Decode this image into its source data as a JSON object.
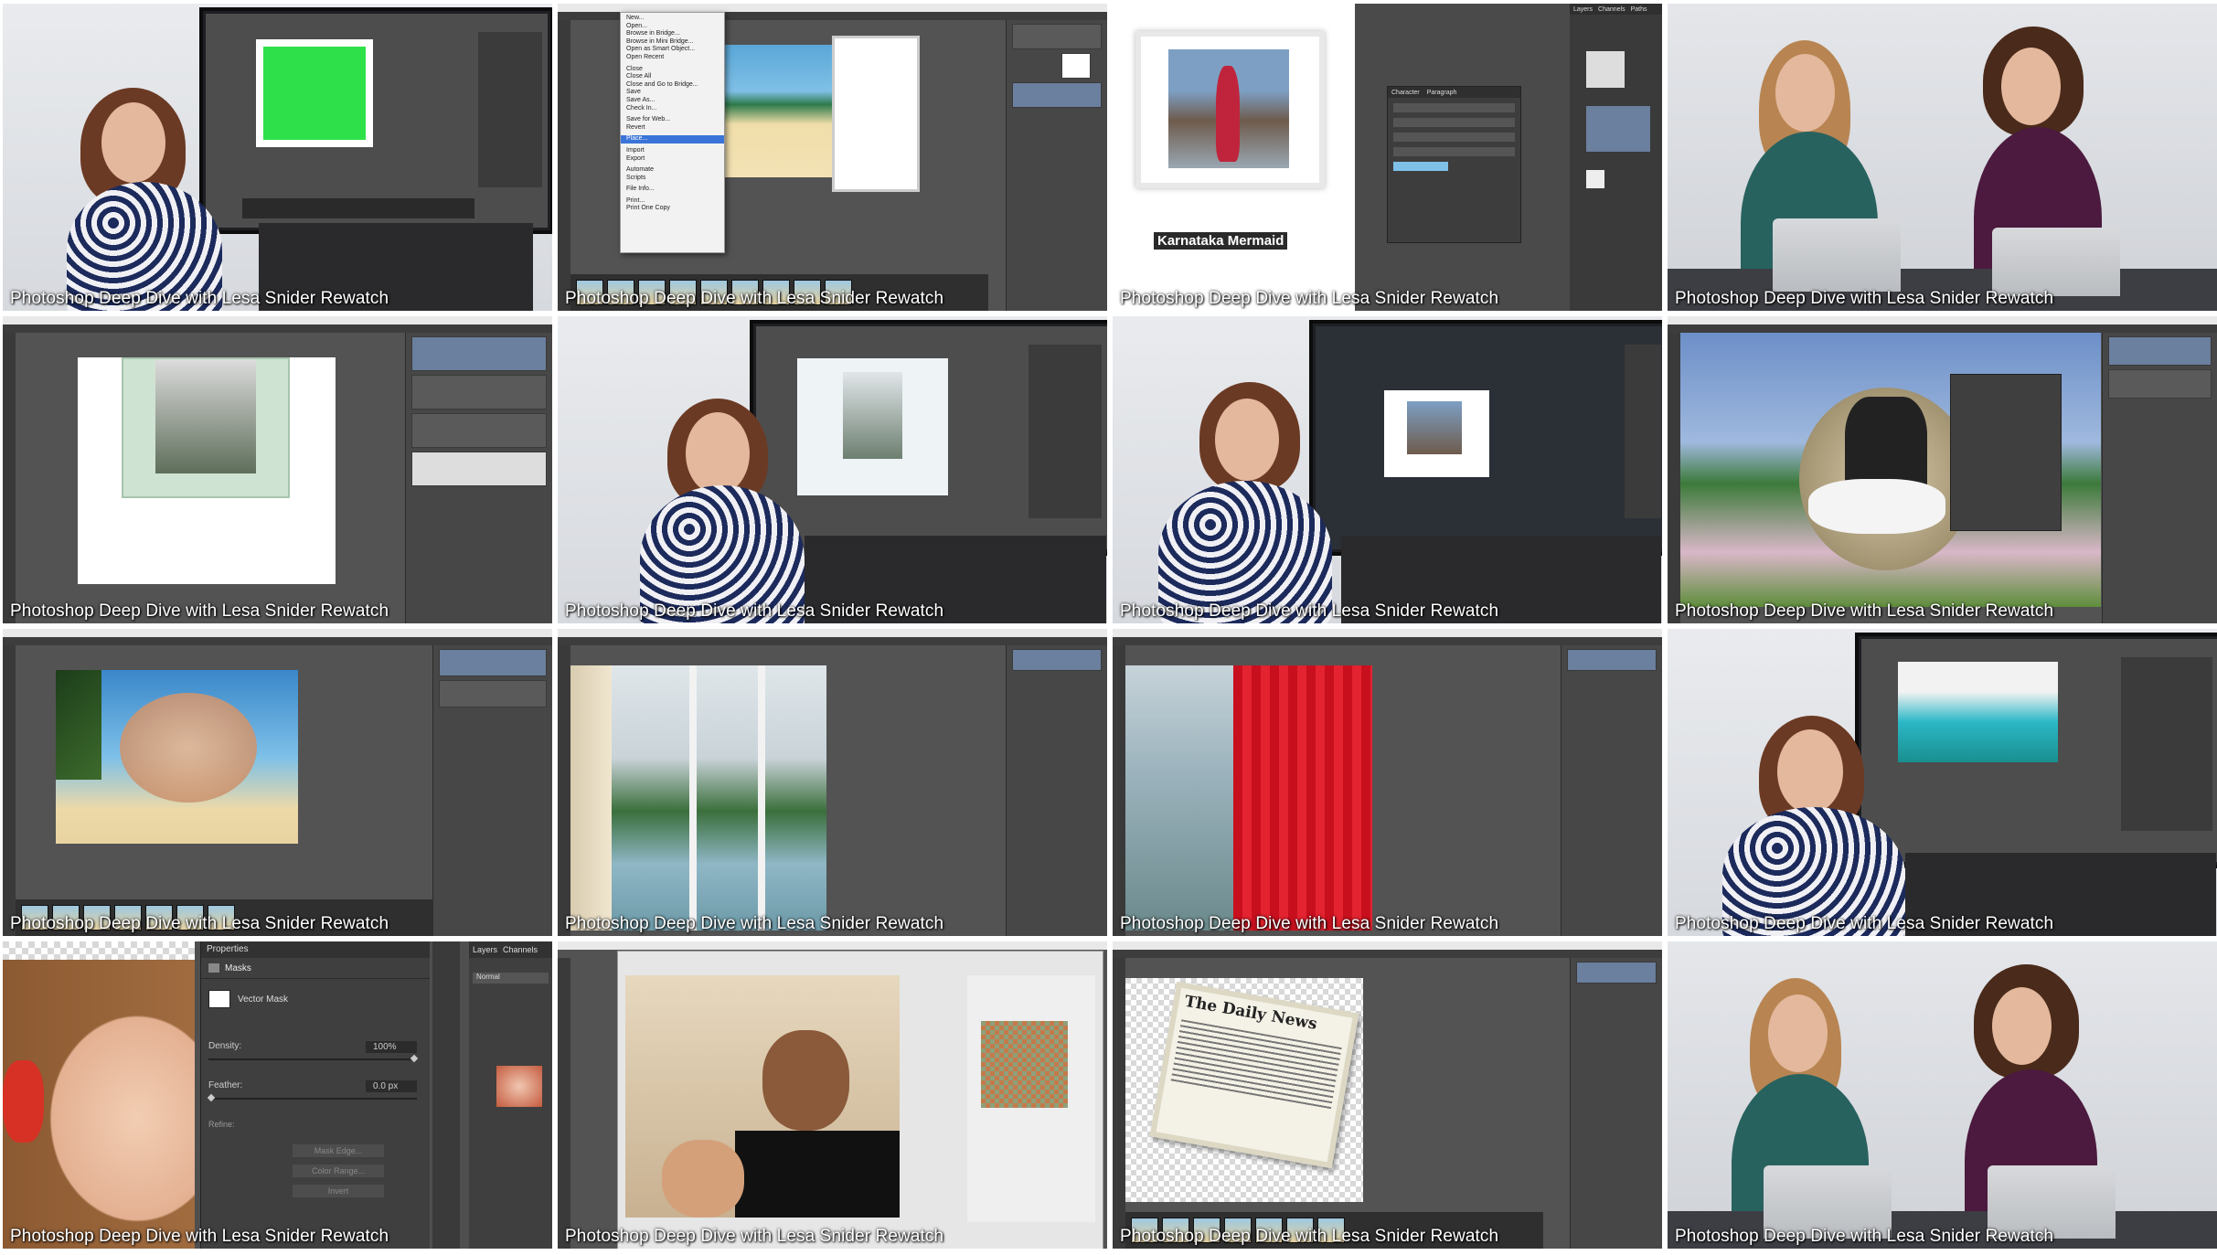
{
  "caption": "Photoshop Deep Dive with Lesa Snider Rewatch",
  "tiles": [
    {
      "scene": "instructor-with-monitor-green-screen"
    },
    {
      "scene": "photoshop-file-menu",
      "menu_items": [
        "New...",
        "Open...",
        "Browse in Bridge...",
        "Browse in Mini Bridge...",
        "Open as Smart Object...",
        "Open Recent",
        "Close",
        "Close All",
        "Close and Go to Bridge...",
        "Save",
        "Save As...",
        "Check In...",
        "Save for Web...",
        "Revert",
        "Place...",
        "Import",
        "Export",
        "Automate",
        "Scripts",
        "File Info...",
        "Print...",
        "Print One Copy"
      ],
      "highlighted": "Place..."
    },
    {
      "scene": "photoshop-character-panel",
      "title_text": "Karnataka Mermaid",
      "panel_tabs": [
        "Character",
        "Paragraph"
      ],
      "layers_tabs": [
        "Layers",
        "Channels",
        "Paths"
      ]
    },
    {
      "scene": "two-hosts-with-laptops"
    },
    {
      "scene": "photoshop-framed-photo"
    },
    {
      "scene": "instructor-with-monitor-beach-photo"
    },
    {
      "scene": "instructor-with-monitor-mermaid-photo"
    },
    {
      "scene": "photoshop-wedding-mask"
    },
    {
      "scene": "photoshop-beach-face-blend"
    },
    {
      "scene": "photoshop-window-mountains"
    },
    {
      "scene": "photoshop-red-curtain"
    },
    {
      "scene": "instructor-with-monitor-window-scene"
    },
    {
      "scene": "photoshop-properties-panel",
      "panel_title": "Properties",
      "section": "Masks",
      "mask_label": "Vector Mask",
      "density_label": "Density:",
      "density_value": "100%",
      "feather_label": "Feather:",
      "feather_value": "0.0 px",
      "refine_label": "Refine:",
      "buttons": [
        "Mask Edge...",
        "Color Range...",
        "Invert"
      ],
      "layers_tabs": [
        "Layers",
        "Channels"
      ],
      "blend_mode": "Normal"
    },
    {
      "scene": "photoshop-save-for-web"
    },
    {
      "scene": "photoshop-daily-news",
      "newspaper_title": "The Daily News"
    },
    {
      "scene": "two-hosts-with-laptops-2"
    }
  ]
}
